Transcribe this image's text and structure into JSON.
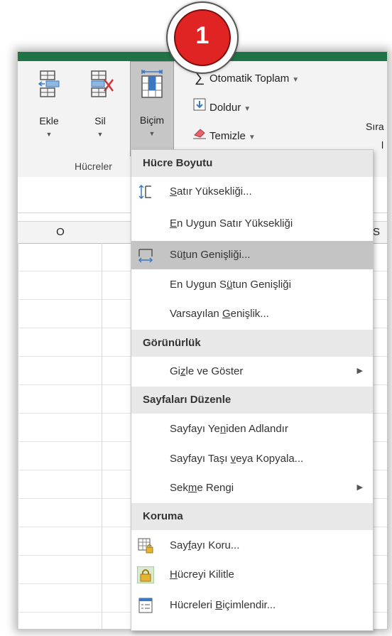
{
  "badge": {
    "number": "1"
  },
  "ribbon": {
    "buttons": [
      {
        "label": "Ekle",
        "icon": "insert-cells-icon"
      },
      {
        "label": "Sil",
        "icon": "delete-cells-icon"
      },
      {
        "label": "Biçim",
        "icon": "format-cells-icon"
      }
    ],
    "group_label": "Hücreler",
    "editing": {
      "autosum": "Otomatik Toplam",
      "fill": "Doldur",
      "clear": "Temizle",
      "sort_partial": "Sıra",
      "sort_partial2": "l"
    }
  },
  "sheet": {
    "column_o": "O",
    "column_s": "S"
  },
  "menu": {
    "sections": {
      "cell_size": "Hücre Boyutu",
      "visibility": "Görünürlük",
      "organize_sheets": "Sayfaları Düzenle",
      "protection": "Koruma"
    },
    "items": {
      "row_height": {
        "pre": "",
        "u": "S",
        "post": "atır Yüksekliği..."
      },
      "autofit_row_height": {
        "pre": "",
        "u": "E",
        "post": "n Uygun Satır Yüksekliği"
      },
      "column_width": {
        "pre": "Sü",
        "u": "t",
        "post": "un Genişliği..."
      },
      "autofit_column_width": {
        "pre": "En Uygun S",
        "u": "ü",
        "post": "tun Genişliği"
      },
      "default_width": {
        "pre": "Varsayılan ",
        "u": "G",
        "post": "enişlik..."
      },
      "hide_unhide": {
        "pre": "Gi",
        "u": "z",
        "post": "le ve Göster"
      },
      "rename_sheet": {
        "pre": "Sayfayı Ye",
        "u": "n",
        "post": "iden Adlandır"
      },
      "move_copy_sheet": {
        "pre": "Sayfayı Taşı ",
        "u": "v",
        "post": "eya Kopyala..."
      },
      "tab_color": {
        "pre": "Sek",
        "u": "m",
        "post": "e Rengi"
      },
      "protect_sheet": {
        "pre": "Say",
        "u": "f",
        "post": "ayı Koru..."
      },
      "lock_cell": {
        "pre": "",
        "u": "H",
        "post": "ücreyi Kilitle"
      },
      "format_cells": {
        "pre": "Hücreleri ",
        "u": "B",
        "post": "içimlendir..."
      }
    },
    "highlighted_item": "column_width"
  },
  "colors": {
    "excel_green": "#217346",
    "badge_red": "#e02424",
    "menu_highlight": "#c4c4c4",
    "section_bg": "#e8e8e8"
  }
}
